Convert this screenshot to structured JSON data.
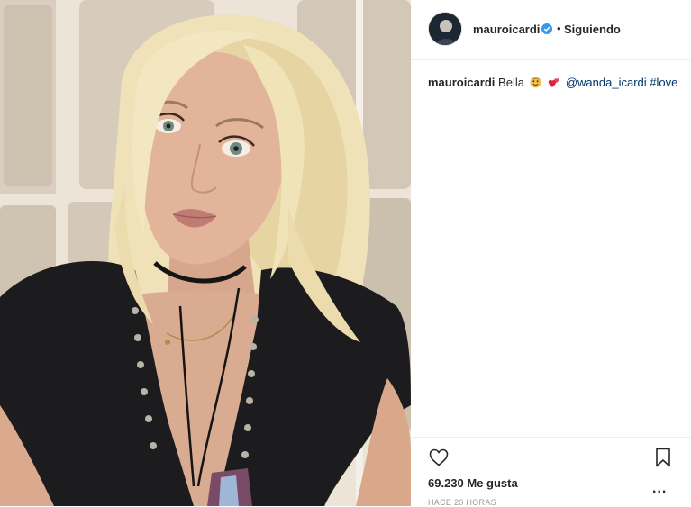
{
  "post": {
    "username": "mauroicardi",
    "dot": "•",
    "follow_status": "Siguiendo",
    "caption": {
      "username": "mauroicardi",
      "text": "Bella",
      "mention": "@wanda_icardi",
      "hashtag": "#love"
    },
    "likes": "69.230 Me gusta",
    "timestamp": "HACE 20 HORAS",
    "more": "..."
  },
  "icons": {
    "verified": "verified-badge-icon",
    "like": "heart-icon",
    "save": "bookmark-icon",
    "options": "more-options-icon"
  },
  "colors": {
    "verified": "#3897f0",
    "link": "#003569",
    "muted": "#999999"
  }
}
